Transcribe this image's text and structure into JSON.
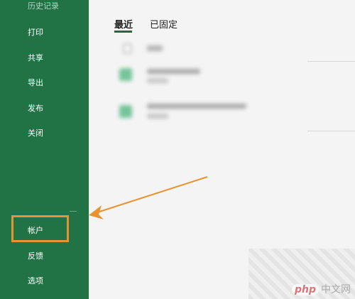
{
  "sidebar": {
    "items": [
      {
        "label": "历史记录",
        "faded": true
      },
      {
        "label": "打印"
      },
      {
        "label": "共享"
      },
      {
        "label": "导出"
      },
      {
        "label": "发布"
      },
      {
        "label": "关闭"
      },
      {
        "label": "帐户"
      },
      {
        "label": "反馈"
      },
      {
        "label": "选项"
      }
    ],
    "highlighted_item": "帐户"
  },
  "main": {
    "tabs": [
      {
        "label": "最近",
        "active": true
      },
      {
        "label": "已固定",
        "active": false
      }
    ]
  },
  "annotation": {
    "arrow_color": "#e8932f",
    "highlight_color": "#e8932f"
  },
  "watermark": {
    "logo": "php",
    "text": "中文网"
  },
  "colors": {
    "sidebar": "#217346",
    "background": "#f4f4f4",
    "file_icon": "#75c49a"
  }
}
